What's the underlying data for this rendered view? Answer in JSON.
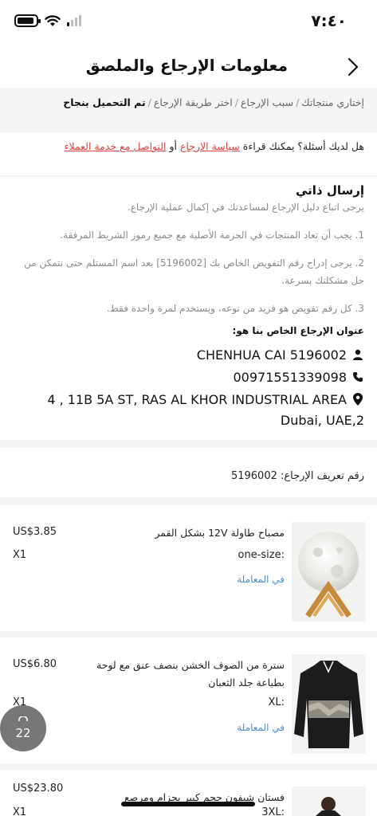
{
  "status": {
    "time": "٧:٤٠"
  },
  "header": {
    "title": "معلومات الإرجاع والملصق"
  },
  "breadcrumb": {
    "steps": [
      "إختاري منتجاتك",
      "سبب الإرجاع",
      "اختر طريقة الإرجاع",
      "تم التحميل بنجاح"
    ],
    "separator": "/"
  },
  "help": {
    "prefix": "هل لديك أسئلة؟ يمكنك قراءة ",
    "policy_link": "سياسة الإرجاع",
    "or": " أو ",
    "contact_link": "التواصل مع خدمة العملاء"
  },
  "instructions": {
    "title": "إرسال ذاتي",
    "subtitle": "يرجى اتباع دليل الإرجاع لمساعدتك في إكمال عملية الإرجاع.",
    "step1": "1. يجب أن تعاد المنتجات في الحزمة الأصلية مع جميع رموز الشريط المرفقة.",
    "step2": "2. يرجى إدراج رقم التفويض الخاص بك [5196002] بعد اسم المستلم حتى نتمكن من حل مشكلتك بسرعة.",
    "step3": "3. كل رقم تفويض هو فريد من نوعه، ويستخدم لمرة واحدة فقط.",
    "address_label": "عنوان الإرجاع الخاص بنا هو:",
    "recipient": "CHENHUA CAI 5196002",
    "phone": "00971551339098",
    "address_line1": "4 , 11B 5A ST,   RAS AL KHOR INDUSTRIAL AREA",
    "address_line2": "2,Dubai, UAE"
  },
  "return_id": {
    "label": "رقم تعريف الإرجاع:",
    "value": "5196002"
  },
  "items": [
    {
      "name": "مصباح طاولة 12V بشكل القمر",
      "price": "US$3.85",
      "qty": "X1",
      "size": "one-size:",
      "status": "في المعاملة"
    },
    {
      "name": "سترة من الصوف الخشن بنصف عنق مع لوحة بطباعة جلد الثعبان",
      "price": "US$6.80",
      "qty": "X1",
      "size": "XL:",
      "status": "في المعاملة"
    },
    {
      "name": "فستان شيفون حجم كبير بحزام ومرصع",
      "price": "US$23.80",
      "qty": "X1",
      "size": "3XL:",
      "status": ""
    }
  ],
  "cart": {
    "count": "22"
  },
  "colors": {
    "link_red": "#e0403a",
    "status_blue": "#4a8fd8",
    "background": "#f4f4f4"
  }
}
